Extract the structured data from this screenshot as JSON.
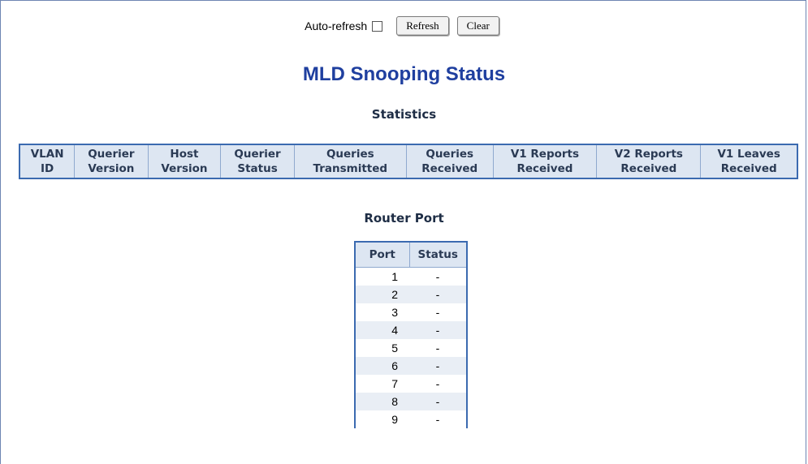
{
  "refresh_bar": {
    "auto_refresh_label": "Auto-refresh",
    "auto_refresh_checked": false,
    "refresh_label": "Refresh",
    "clear_label": "Clear"
  },
  "page_title": "MLD Snooping Status",
  "statistics": {
    "title": "Statistics",
    "columns": [
      [
        "VLAN",
        "ID"
      ],
      [
        "Querier",
        "Version"
      ],
      [
        "Host",
        "Version"
      ],
      [
        "Querier",
        "Status"
      ],
      [
        "Queries",
        "Transmitted"
      ],
      [
        "Queries",
        "Received"
      ],
      [
        "V1 Reports",
        "Received"
      ],
      [
        "V2 Reports",
        "Received"
      ],
      [
        "V1 Leaves",
        "Received"
      ]
    ]
  },
  "router_port": {
    "title": "Router Port",
    "headers": {
      "port": "Port",
      "status": "Status"
    },
    "rows": [
      {
        "port": "1",
        "status": "-"
      },
      {
        "port": "2",
        "status": "-"
      },
      {
        "port": "3",
        "status": "-"
      },
      {
        "port": "4",
        "status": "-"
      },
      {
        "port": "5",
        "status": "-"
      },
      {
        "port": "6",
        "status": "-"
      },
      {
        "port": "7",
        "status": "-"
      },
      {
        "port": "8",
        "status": "-"
      },
      {
        "port": "9",
        "status": "-"
      }
    ]
  },
  "colors": {
    "title": "#1f3f9f",
    "table_border": "#3b6ab0",
    "header_bg": "#dde6f2",
    "alt_row_bg": "#e9eef5"
  }
}
